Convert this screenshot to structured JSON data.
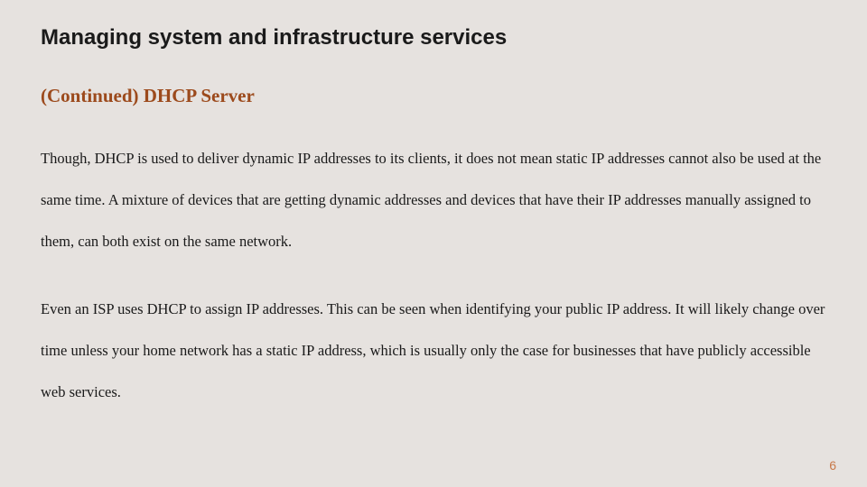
{
  "title": "Managing system and infrastructure services",
  "subtitle": "(Continued) DHCP Server",
  "paragraphs": {
    "p1": "Though, DHCP is used to deliver dynamic IP addresses to its clients, it does not mean static IP addresses cannot also be used at the same time. A mixture of devices that are getting dynamic addresses and devices that have their IP addresses manually assigned to them, can both exist on the same network.",
    "p2": "Even an ISP uses DHCP to assign IP addresses. This can be seen when identifying your public IP address. It will likely change over time unless your home network has a static IP address, which is usually only the case for businesses that have publicly accessible web services."
  },
  "pageNumber": "6"
}
